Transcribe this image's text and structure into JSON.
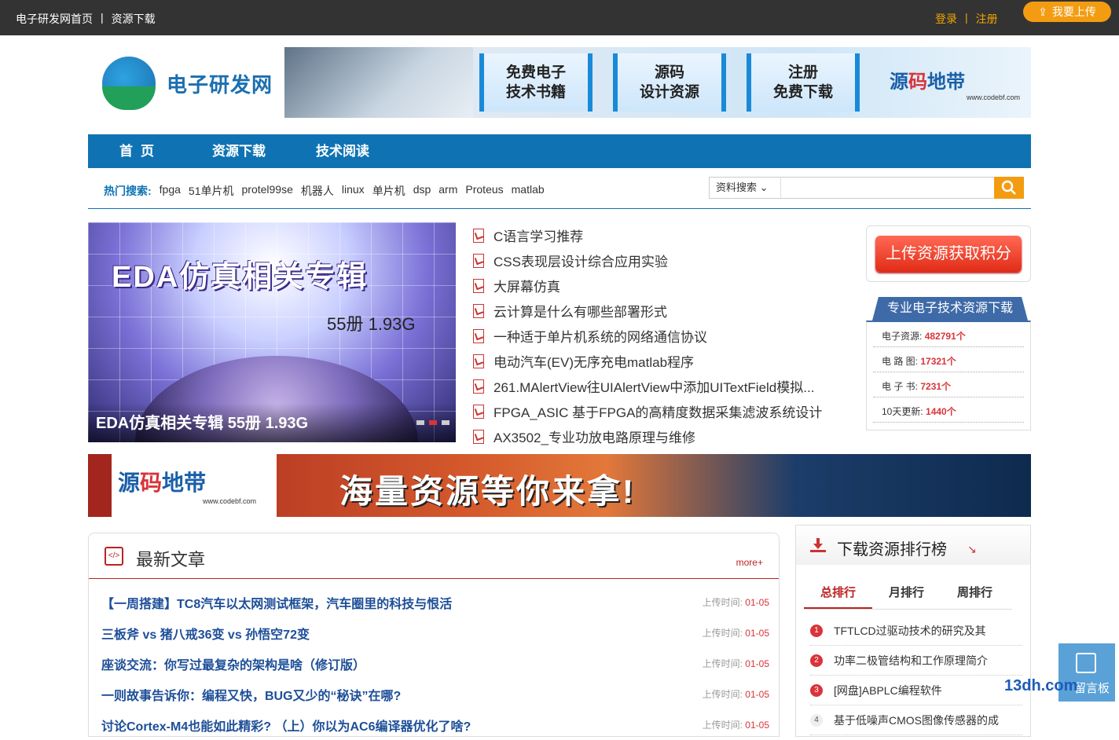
{
  "topbar": {
    "home": "电子研发网首页",
    "sep": "|",
    "download": "资源下载",
    "login": "登录",
    "register": "注册",
    "upload": "我要上传"
  },
  "logo": {
    "text": "电子研发网"
  },
  "banner_top": {
    "box1": "免费电子\n技术书籍",
    "box1_l1": "免费电子",
    "box1_l2": "技术书籍",
    "box2_l1": "源码",
    "box2_l2": "设计资源",
    "box3_l1": "注册",
    "box3_l2": "免费下载",
    "brand_a": "源",
    "brand_b": "码",
    "brand_c": "地带",
    "brand_url": "www.codebf.com"
  },
  "nav": {
    "items": [
      "首页",
      "资源下载",
      "技术阅读"
    ]
  },
  "hot": {
    "label": "热门搜索:",
    "keywords": [
      "fpga",
      "51单片机",
      "protel99se",
      "机器人",
      "linux",
      "单片机",
      "dsp",
      "arm",
      "Proteus",
      "matlab"
    ]
  },
  "search": {
    "select": "资料搜索",
    "placeholder": ""
  },
  "slider": {
    "title": "EDA仿真相关专辑",
    "sub": "55册 1.93G",
    "caption": "EDA仿真相关专辑 55册 1.93G"
  },
  "articles": [
    "C语言学习推荐",
    "CSS表现层设计综合应用实验",
    "大屏幕仿真",
    "云计算是什么有哪些部署形式",
    "一种适于单片机系统的网络通信协议",
    "电动汽车(EV)无序充电matlab程序",
    "261.MAlertView往UIAlertView中添加UITextField模拟...",
    "FPGA_ASIC 基于FPGA的高精度数据采集滤波系统设计",
    "AX3502_专业功放电路原理与维修"
  ],
  "side": {
    "upload_btn": "上传资源获取积分",
    "stats_title": "专业电子技术资源下载",
    "stats": [
      {
        "label": "电子资源:",
        "value": "482791个"
      },
      {
        "label": "电 路 图:",
        "value": "17321个"
      },
      {
        "label": "电 子 书:",
        "value": "7231个"
      },
      {
        "label": "10天更新:",
        "value": "1440个"
      }
    ]
  },
  "ad": {
    "brand_a": "源",
    "brand_b": "码",
    "brand_c": "地带",
    "brand_url": "www.codebf.com",
    "slogan": "海量资源等你来拿!"
  },
  "latest": {
    "title": "最新文章",
    "more": "more+",
    "date_label": "上传时间:",
    "items": [
      {
        "title": "【一周搭建】TC8汽车以太网测试框架，汽车圈里的科技与恨活",
        "date": "01-05"
      },
      {
        "title": "三板斧 vs 猪八戒36变 vs 孙悟空72变",
        "date": "01-05"
      },
      {
        "title": "座谈交流：你写过最复杂的架构是啥（修订版）",
        "date": "01-05"
      },
      {
        "title": "一则故事告诉你：编程又快，BUG又少的“秘诀”在哪?",
        "date": "01-05"
      },
      {
        "title": "讨论Cortex-M4也能如此精彩? （上）你以为AC6编译器优化了啥?",
        "date": "01-05"
      }
    ]
  },
  "rank": {
    "title": "下载资源排行榜",
    "tabs": [
      "总排行",
      "月排行",
      "周排行"
    ],
    "items": [
      {
        "num": "1",
        "title": "TFTLCD过驱动技术的研究及其"
      },
      {
        "num": "2",
        "title": "功率二极管结构和工作原理简介"
      },
      {
        "num": "3",
        "title": "[网盘]ABPLC编程软件"
      },
      {
        "num": "4",
        "title": "基于低噪声CMOS图像传感器的成"
      }
    ]
  },
  "float": {
    "label": "留言板",
    "watermark": "13dh.com"
  }
}
